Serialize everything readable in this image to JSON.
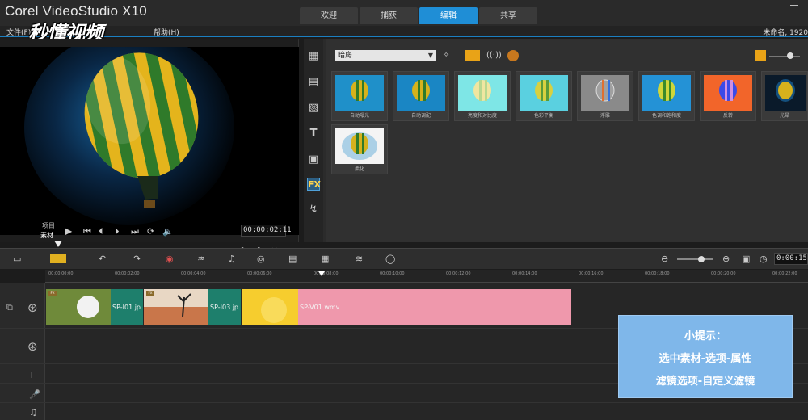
{
  "app": {
    "title": "Corel VideoStudio X10",
    "project_name": "未命名, 1920"
  },
  "tabs": [
    {
      "label": "欢迎",
      "active": false
    },
    {
      "label": "捕获",
      "active": false
    },
    {
      "label": "编辑",
      "active": true
    },
    {
      "label": "共享",
      "active": false
    }
  ],
  "menu": {
    "file": "文件(F)",
    "help": "帮助(H)"
  },
  "watermark": "秒懂视频",
  "preview": {
    "mode_project": "项目",
    "mode_clip": "素材",
    "timecode": "00:00:02:11",
    "scrub_position": 0.24
  },
  "library": {
    "category": "暗房",
    "thumbnails": [
      {
        "caption": "自动曝光",
        "bg": "#1f90c9"
      },
      {
        "caption": "自动调配",
        "bg": "#1a86c4"
      },
      {
        "caption": "亮度和对比度",
        "bg": "#7ee6e6"
      },
      {
        "caption": "色彩平衡",
        "bg": "#5ad0e0"
      },
      {
        "caption": "浮雕",
        "bg": "#8a8a8a"
      },
      {
        "caption": "色调和饱和度",
        "bg": "#2492d6"
      },
      {
        "caption": "反转",
        "bg": "#f2652a"
      },
      {
        "caption": "光晕",
        "bg": "#0a1a2a"
      },
      {
        "caption": "柔化",
        "bg": "#f4f4f4"
      }
    ],
    "sidebar_icons": [
      "media-icon",
      "instant-project-icon",
      "transition-icon",
      "title-icon",
      "graphic-icon",
      "fx-icon",
      "path-icon"
    ]
  },
  "timeline": {
    "time_display": "0:00:15",
    "ticks": [
      "00:00:00:00",
      "00:00:02:00",
      "00:00:04:00",
      "00:00:06:00",
      "00:00:08:00",
      "00:00:10:00",
      "00:00:12:00",
      "00:00:14:00",
      "00:00:16:00",
      "00:00:18:00",
      "00:00:20:00",
      "00:00:22:00"
    ],
    "clips": [
      {
        "label": "SP-I01.jp",
        "color": "#1e7f6c"
      },
      {
        "label": "SP-I03.jp",
        "color": "#1e7f6c"
      },
      {
        "label": "SP-V01.wmv",
        "color": "#ef98ac"
      }
    ]
  },
  "hint": {
    "title": "小提示：",
    "line1": "选中素材-选项-属性",
    "line2": "滤镜选项-自定义滤镜"
  }
}
